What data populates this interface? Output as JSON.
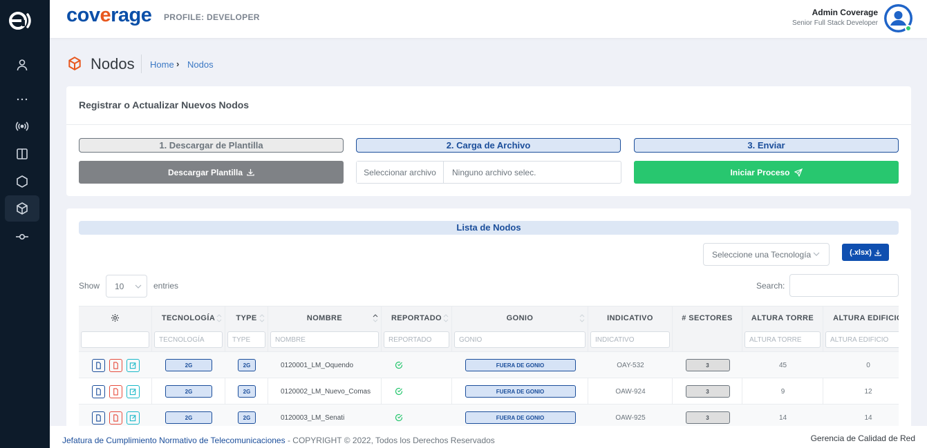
{
  "sidebar": {
    "items": [
      {
        "name": "user-icon"
      },
      {
        "name": "more-icon"
      },
      {
        "name": "broadcast-icon"
      },
      {
        "name": "columns-icon"
      },
      {
        "name": "hexagon-icon"
      },
      {
        "name": "box-icon",
        "active": true
      },
      {
        "name": "commit-icon"
      }
    ]
  },
  "topbar": {
    "brand_pre": "cov",
    "brand_e": "e",
    "brand_post": "rage",
    "profile": "PROFILE: DEVELOPER",
    "user_name": "Admin Coverage",
    "user_role": "Senior Full Stack Developer"
  },
  "page": {
    "title": "Nodos",
    "breadcrumb_home": "Home",
    "breadcrumb_sep": "›",
    "breadcrumb_current": "Nodos"
  },
  "register": {
    "title": "Registrar o Actualizar Nuevos Nodos",
    "step1": "1. Descargar de Plantilla",
    "step2": "2. Carga de Archivo",
    "step3": "3. Enviar",
    "download_label": "Descargar Plantilla",
    "file_button": "Seleccionar archivo",
    "file_text": "Ninguno archivo selec.",
    "send_label": "Iniciar Proceso"
  },
  "list": {
    "title": "Lista de Nodos",
    "tech_placeholder": "Seleccione una Tecnología",
    "export_label": "(.xlsx)",
    "show_label": "Show",
    "show_value": "10",
    "entries_label": "entries",
    "search_label": "Search:"
  },
  "table": {
    "headers": {
      "tecnologia": "TECNOLOGÍA",
      "type": "TYPE",
      "nombre": "NOMBRE",
      "reportado": "REPORTADO",
      "gonio": "GONIO",
      "indicativo": "INDICATIVO",
      "sectores": "# SECTORES",
      "altura_torre": "ALTURA TORRE",
      "altura_edificio": "ALTURA EDIFICIO"
    },
    "filters": {
      "tecnologia": "TECNOLOGÍA",
      "type": "TYPE",
      "nombre": "NOMBRE",
      "reportado": "REPORTADO",
      "gonio": "GONIO",
      "indicativo": "INDICATIVO",
      "altura_torre": "ALTURA TORRE",
      "altura_edificio": "ALTURA EDIFICIO"
    },
    "rows": [
      {
        "tecnologia": "2G",
        "type": "2G",
        "nombre": "0120001_LM_Oquendo",
        "gonio": "FUERA DE GONIO",
        "indicativo": "OAY-532",
        "sectores": "3",
        "altura_torre": "45",
        "altura_edificio": "0"
      },
      {
        "tecnologia": "2G",
        "type": "2G",
        "nombre": "0120002_LM_Nuevo_Comas",
        "gonio": "FUERA DE GONIO",
        "indicativo": "OAW-924",
        "sectores": "3",
        "altura_torre": "9",
        "altura_edificio": "12"
      },
      {
        "tecnologia": "2G",
        "type": "2G",
        "nombre": "0120003_LM_Senati",
        "gonio": "FUERA DE GONIO",
        "indicativo": "OAW-925",
        "sectores": "3",
        "altura_torre": "14",
        "altura_edificio": "14"
      }
    ]
  },
  "footer": {
    "link": "Jefatura de Cumplimiento Normativo de Telecomunicaciones",
    "copyright": " - COPYRIGHT © 2022, Todos los Derechos Reservados",
    "right": "Gerencia de Calidad de Red"
  },
  "colors": {
    "sidebar": "#0d1b2a",
    "brand_blue": "#0b4fa8",
    "brand_orange": "#e8571d",
    "primary": "#1a4d9a",
    "success": "#28c76f"
  }
}
